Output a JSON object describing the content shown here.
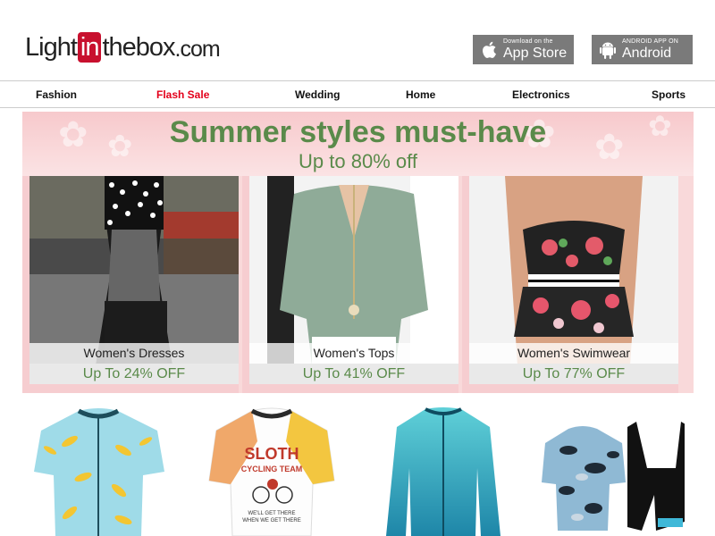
{
  "header": {
    "logo": {
      "part1": "Light",
      "part2": "in",
      "part3": "thebox",
      "part4": ".com"
    },
    "apple_badge": {
      "small": "Download on the",
      "big": "App Store",
      "icon": "apple-icon"
    },
    "android_badge": {
      "small": "ANDROID APP ON",
      "big": "Android",
      "icon": "android-icon"
    }
  },
  "nav": {
    "items": [
      {
        "label": "Fashion"
      },
      {
        "label": "Flash Sale",
        "color": "#e3001b"
      },
      {
        "label": "Wedding"
      },
      {
        "label": "Home"
      },
      {
        "label": "Electronics"
      },
      {
        "label": "Sports"
      }
    ]
  },
  "banner": {
    "title": "Summer styles must-have",
    "subtitle": "Up to 80% off",
    "accent_color": "#5a8a4a",
    "cards": [
      {
        "name": "Women's Dresses",
        "offer": "Up To 24% OFF"
      },
      {
        "name": "Women's Tops",
        "offer": "Up To 41% OFF"
      },
      {
        "name": "Women's Swimwear",
        "offer": "Up To 77% OFF"
      }
    ]
  },
  "products": {
    "jerseys": [
      {
        "icon": "banana-jersey-image"
      },
      {
        "icon": "sloth-jersey-image",
        "print_line1": "SLOTH",
        "print_line2": "CYCLING TEAM",
        "print_line3": "WE'LL GET THERE",
        "print_line4": "WHEN WE GET THERE"
      },
      {
        "icon": "teal-gradient-jersey-image"
      },
      {
        "icon": "camo-jersey-bib-set-image"
      }
    ]
  }
}
